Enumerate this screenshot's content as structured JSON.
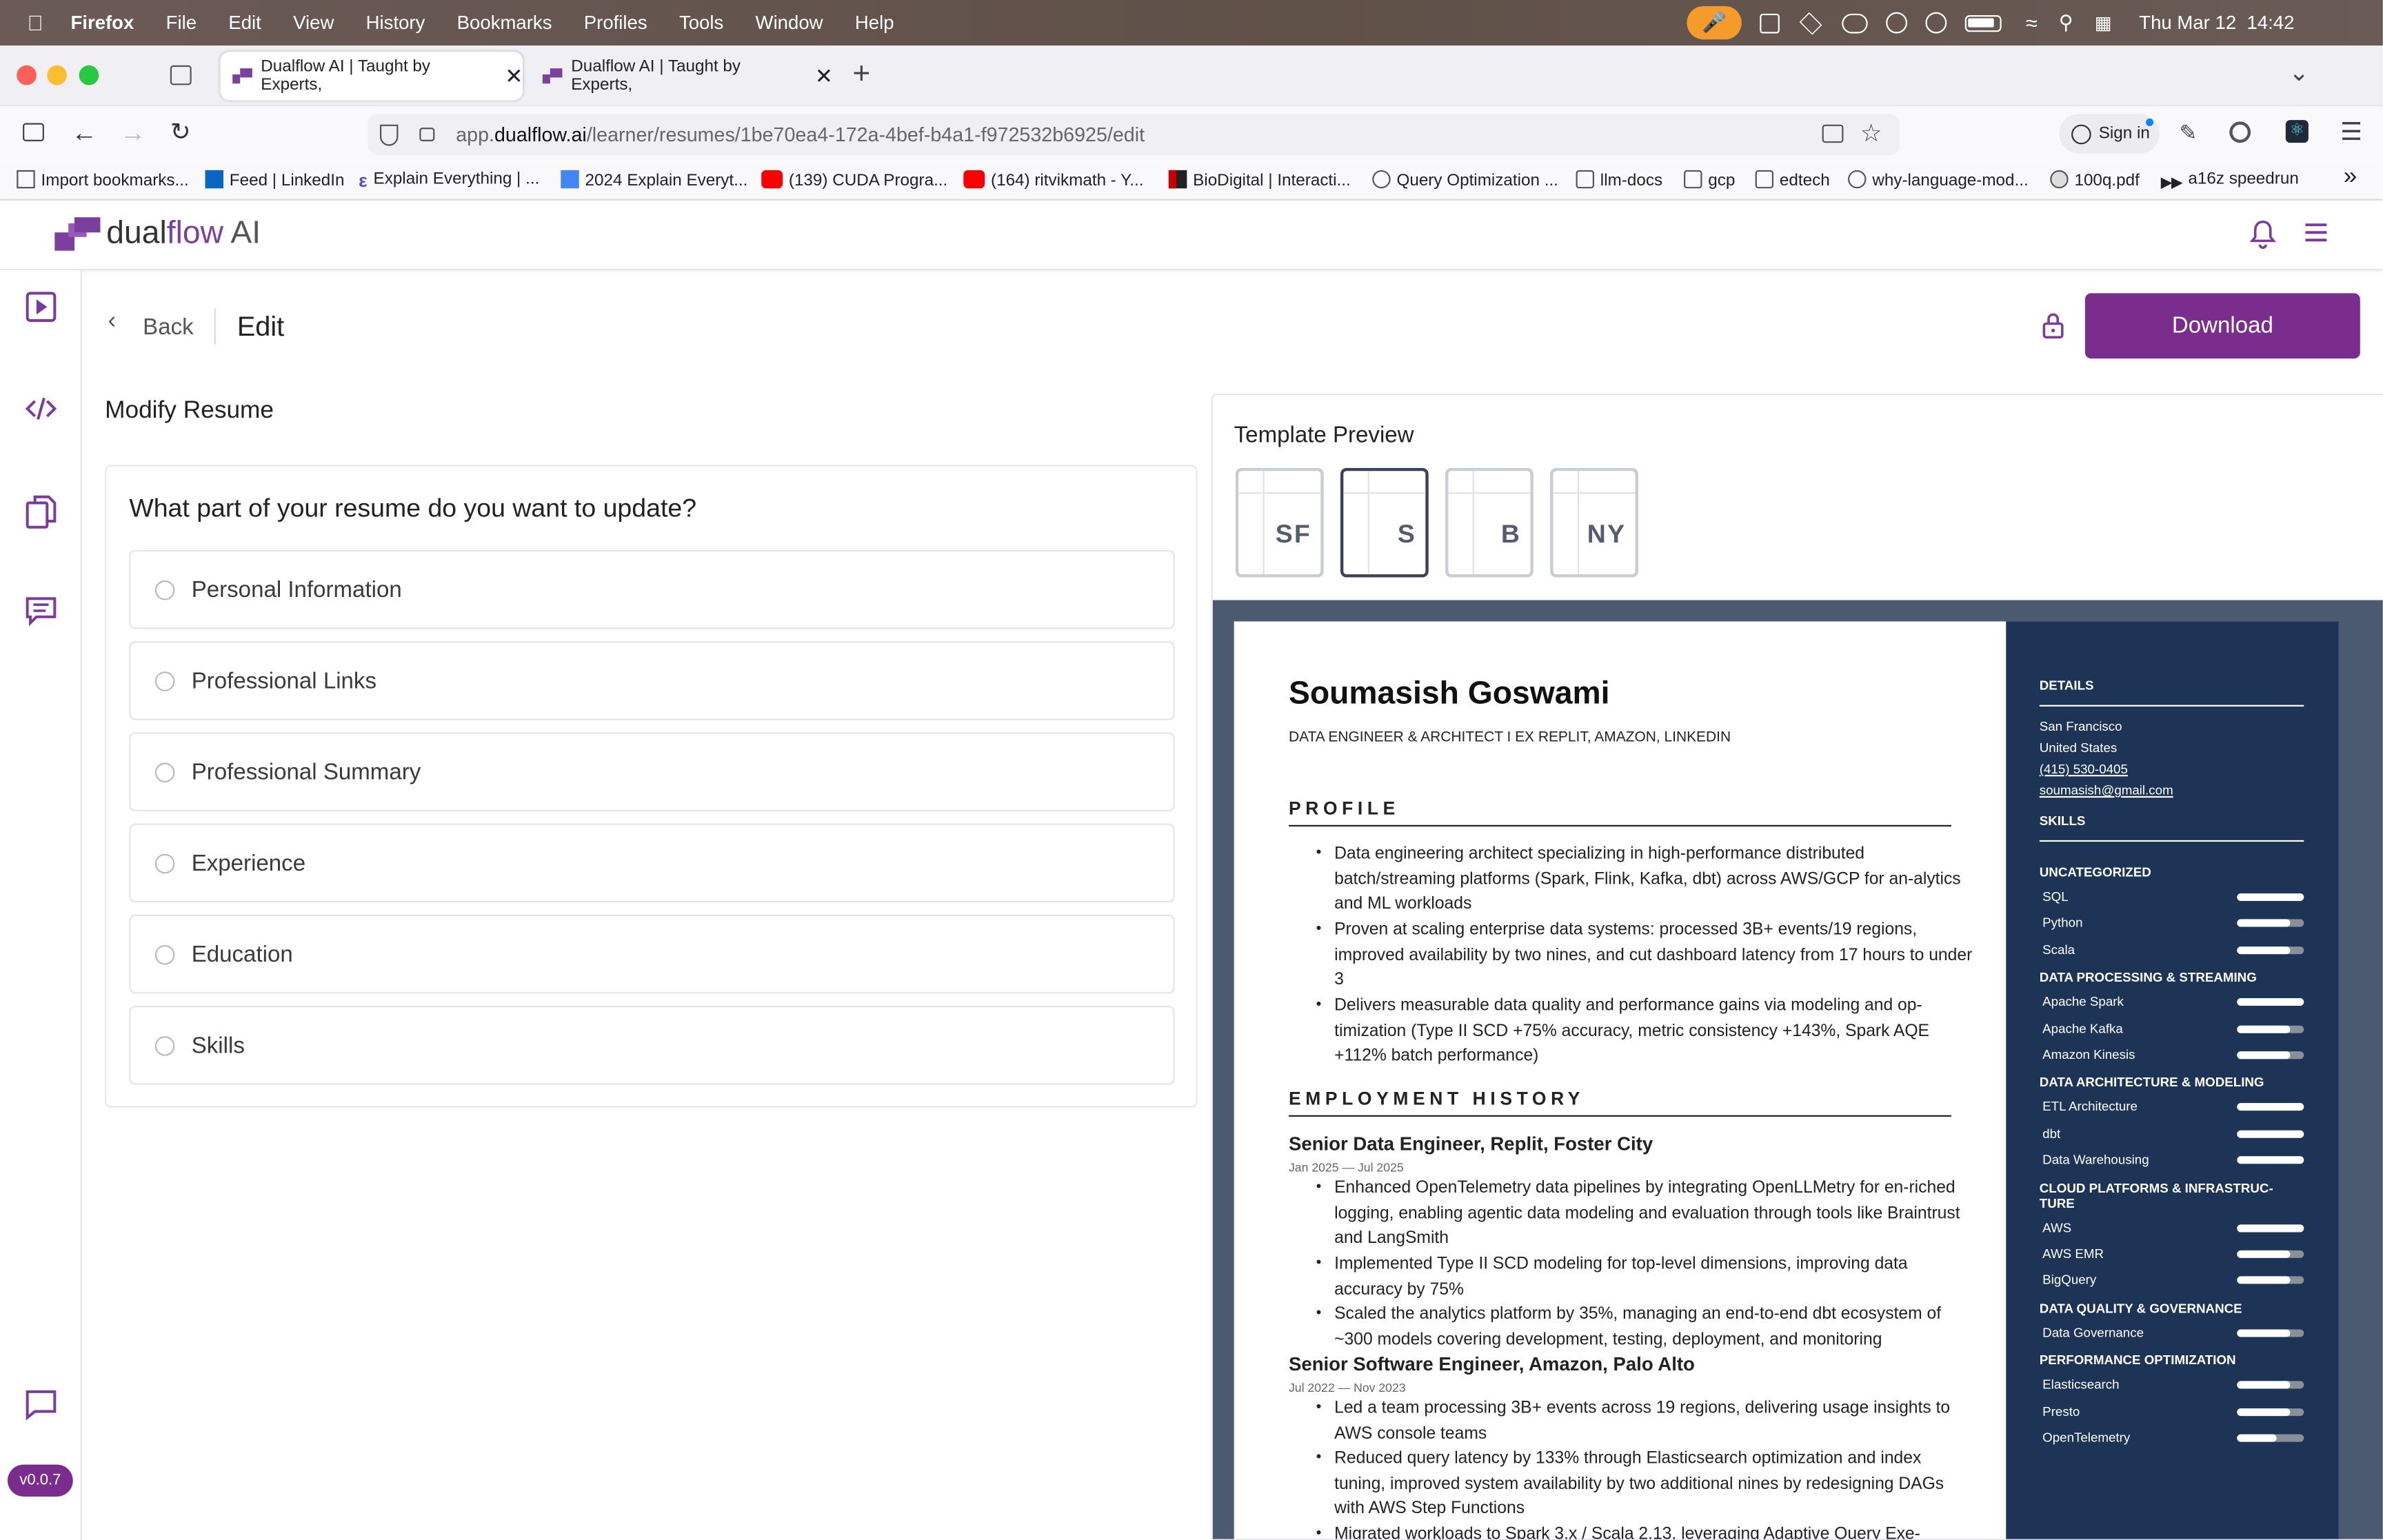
{
  "menubar": {
    "app": "Firefox",
    "items": [
      "File",
      "Edit",
      "View",
      "History",
      "Bookmarks",
      "Profiles",
      "Tools",
      "Window",
      "Help"
    ],
    "clock": "Thu Mar 12  14:42"
  },
  "tabs": [
    {
      "title": "Dualflow AI | Taught by Experts,"
    },
    {
      "title": "Dualflow AI | Taught by Experts,"
    }
  ],
  "url": {
    "pre": "app.",
    "host": "dualflow.ai",
    "path": "/learner/resumes/1be70ea4-172a-4bef-b4a1-f972532b6925/edit"
  },
  "signin": "Sign in",
  "bookmarks": [
    "Import bookmarks...",
    "Feed | LinkedIn",
    "Explain Everything | ...",
    "2024 Explain Everyt...",
    "(139) CUDA Progra...",
    "(164) ritvikmath - Y...",
    "BioDigital | Interacti...",
    "Query Optimization ...",
    "llm-docs",
    "gcp",
    "edtech",
    "why-language-mod...",
    "100q.pdf",
    "a16z speedrun"
  ],
  "logo": {
    "a": "dual",
    "b": "flow",
    "c": " AI"
  },
  "version": "v0.0.7",
  "edit": {
    "back": "Back",
    "title": "Edit",
    "download": "Download",
    "modify": "Modify Resume",
    "question": "What part of your resume do you want to update?",
    "options": [
      "Personal Information",
      "Professional Links",
      "Professional Summary",
      "Experience",
      "Education",
      "Skills"
    ]
  },
  "preview": {
    "title": "Template Preview",
    "templates": [
      "SF",
      "S",
      "B",
      "NY"
    ],
    "selected": "S"
  },
  "resume": {
    "name": "Soumasish Goswami",
    "headline": "DATA ENGINEER & ARCHITECT I EX REPLIT, AMAZON, LINKEDIN",
    "profile_h": "PROFILE",
    "profile": [
      "Data engineering architect specializing in high-performance distributed batch/streaming platforms (Spark, Flink, Kafka, dbt) across AWS/GCP for an-alytics and ML workloads",
      "Proven at scaling enterprise data systems: processed 3B+ events/19 regions, improved availability by two nines, and cut dashboard latency from 17 hours to under 3",
      "Delivers measurable data quality and performance gains via modeling and op-timization (Type II SCD +75% accuracy, metric consistency +143%, Spark AQE +112% batch performance)"
    ],
    "emp_h": "EMPLOYMENT HISTORY",
    "jobs": [
      {
        "title": "Senior Data Engineer, Replit, Foster City",
        "dates": "Jan 2025 — Jul 2025",
        "bullets": [
          "Enhanced OpenTelemetry data pipelines by integrating OpenLLMetry for en-riched logging, enabling agentic data modeling and evaluation through tools like Braintrust and LangSmith",
          "Implemented Type II SCD modeling for top-level dimensions, improving data accuracy by 75%",
          "Scaled the analytics platform by 35%, managing an end-to-end dbt ecosystem of ~300 models covering development, testing, deployment, and monitoring"
        ]
      },
      {
        "title": "Senior Software Engineer, Amazon, Palo Alto",
        "dates": "Jul 2022 — Nov 2023",
        "bullets": [
          "Led a team processing 3B+ events across 19 regions, delivering usage insights to AWS console teams",
          "Reduced query latency by 133% through Elasticsearch optimization and index tuning, improved system availability by two additional nines by redesigning DAGs with AWS Step Functions",
          "Migrated workloads to Spark 3.x / Scala 2.13, leveraging Adaptive Query Exe-"
        ]
      }
    ],
    "details_h": "DETAILS",
    "details": [
      "San Francisco",
      "United States",
      "(415) 530-0405",
      "soumasish@gmail.com"
    ],
    "skills_h": "SKILLS",
    "skill_groups": [
      {
        "name": "UNCATEGORIZED",
        "skills": [
          {
            "n": "SQL",
            "l": 1
          },
          {
            "n": "Python",
            "l": 0.8
          },
          {
            "n": "Scala",
            "l": 0.8
          }
        ]
      },
      {
        "name": "DATA PROCESSING & STREAMING",
        "skills": [
          {
            "n": "Apache Spark",
            "l": 1
          },
          {
            "n": "Apache Kafka",
            "l": 0.8
          },
          {
            "n": "Amazon Kinesis",
            "l": 0.8
          }
        ]
      },
      {
        "name": "DATA ARCHITECTURE & MODELING",
        "skills": [
          {
            "n": "ETL Architecture",
            "l": 1
          },
          {
            "n": "dbt",
            "l": 1
          },
          {
            "n": "Data Warehousing",
            "l": 1
          }
        ]
      },
      {
        "name": "CLOUD PLATFORMS & INFRASTRUC-TURE",
        "skills": [
          {
            "n": "AWS",
            "l": 1
          },
          {
            "n": "AWS EMR",
            "l": 0.8
          },
          {
            "n": "BigQuery",
            "l": 0.8
          }
        ]
      },
      {
        "name": "DATA QUALITY & GOVERNANCE",
        "skills": [
          {
            "n": "Data Governance",
            "l": 0.8
          }
        ]
      },
      {
        "name": "PERFORMANCE OPTIMIZATION",
        "skills": [
          {
            "n": "Elasticsearch",
            "l": 0.8
          },
          {
            "n": "Presto",
            "l": 0.8
          },
          {
            "n": "OpenTelemetry",
            "l": 0.6
          }
        ]
      }
    ]
  }
}
